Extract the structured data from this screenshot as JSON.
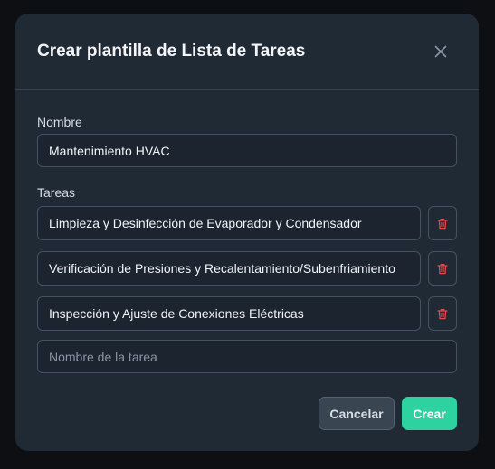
{
  "dialog": {
    "title": "Crear plantilla de Lista de Tareas",
    "close_icon": "close-icon"
  },
  "form": {
    "name_label": "Nombre",
    "name_value": "Mantenimiento HVAC",
    "tasks_label": "Tareas",
    "tasks": [
      {
        "value": "Limpieza y Desinfección de Evaporador y Condensador",
        "delete_icon": "trash-icon"
      },
      {
        "value": "Verificación de Presiones y Recalentamiento/Subenfriamiento",
        "delete_icon": "trash-icon"
      },
      {
        "value": "Inspección y Ajuste de Conexiones Eléctricas",
        "delete_icon": "trash-icon"
      }
    ],
    "new_task_placeholder": "Nombre de la tarea"
  },
  "actions": {
    "cancel_label": "Cancelar",
    "create_label": "Crear"
  },
  "colors": {
    "accent": "#2ed1a0",
    "danger": "#e5484d",
    "background": "#202a35"
  }
}
